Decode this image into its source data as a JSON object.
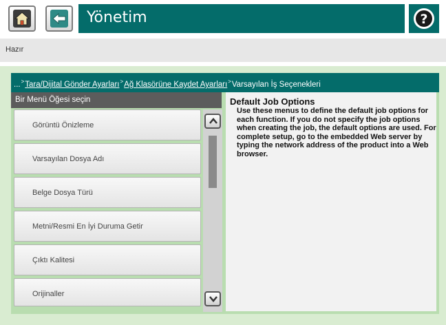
{
  "header": {
    "title": "Yönetim",
    "home_icon": "home-icon",
    "back_icon": "back-arrow-icon",
    "help_icon": "help-question-icon"
  },
  "status": {
    "text": "Hazır"
  },
  "breadcrumb": {
    "prefix": "...",
    "items": [
      "Tara/Dijital Gönder Ayarları",
      "Ağ Klasörüne Kaydet Ayarları",
      "Varsayılan İş Seçenekleri"
    ]
  },
  "menu": {
    "header": "Bir Menü Öğesi seçin",
    "items": [
      "Görüntü Önizleme",
      "Varsayılan Dosya Adı",
      "Belge Dosya Türü",
      "Metni/Resmi En İyi Duruma Getir",
      "Çıktı Kalitesi",
      "Orijinaller"
    ]
  },
  "description": {
    "title": "Default Job Options",
    "body": "Use these menus to define the default job options for each function. If you do not specify the job options when creating the job, the default options are used. For complete setup, go to the embedded Web server by typing the network address of the product into a Web browser."
  },
  "colors": {
    "accent": "#046c6a",
    "panel": "#b9ddb0",
    "status_bar": "#e7e7e7"
  }
}
